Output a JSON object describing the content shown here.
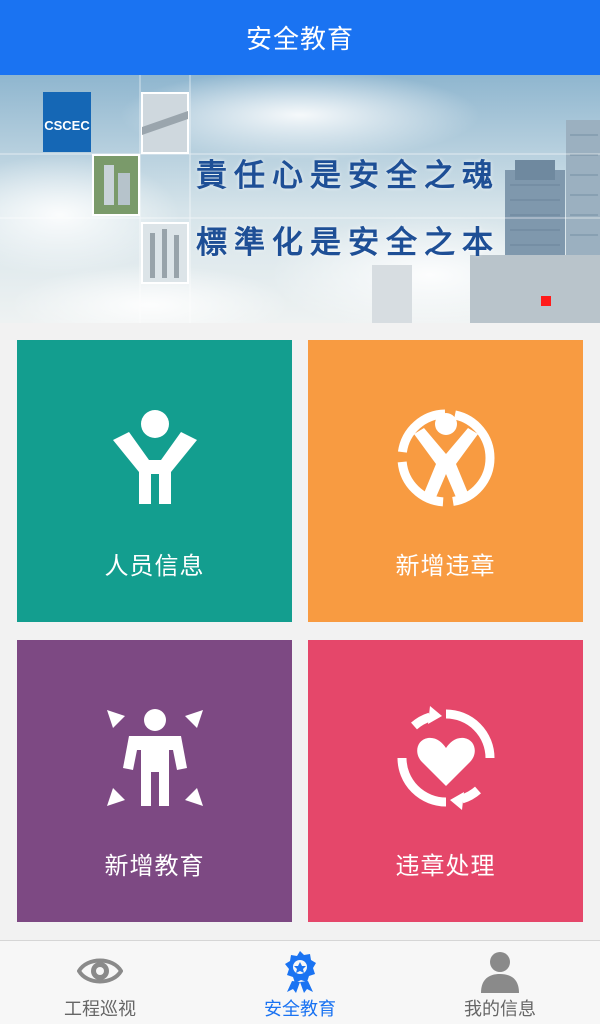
{
  "header": {
    "title": "安全教育"
  },
  "banner": {
    "slogan_line1": "責任心是安全之魂",
    "slogan_line2": "標準化是安全之本",
    "logo_text": "CSCEC"
  },
  "tiles": [
    {
      "label": "人员信息",
      "icon": "person-arms-up-icon",
      "color": "#139e8f"
    },
    {
      "label": "新增违章",
      "icon": "person-circle-icon",
      "color": "#f89b41"
    },
    {
      "label": "新增教育",
      "icon": "person-arrows-icon",
      "color": "#7d4983"
    },
    {
      "label": "违章处理",
      "icon": "heart-refresh-icon",
      "color": "#e5476a"
    }
  ],
  "tabbar": {
    "items": [
      {
        "label": "工程巡视",
        "icon": "eye-icon",
        "active": false
      },
      {
        "label": "安全教育",
        "icon": "badge-icon",
        "active": true
      },
      {
        "label": "我的信息",
        "icon": "user-icon",
        "active": false
      }
    ],
    "active_color": "#1a73f2",
    "inactive_color": "#888888"
  }
}
